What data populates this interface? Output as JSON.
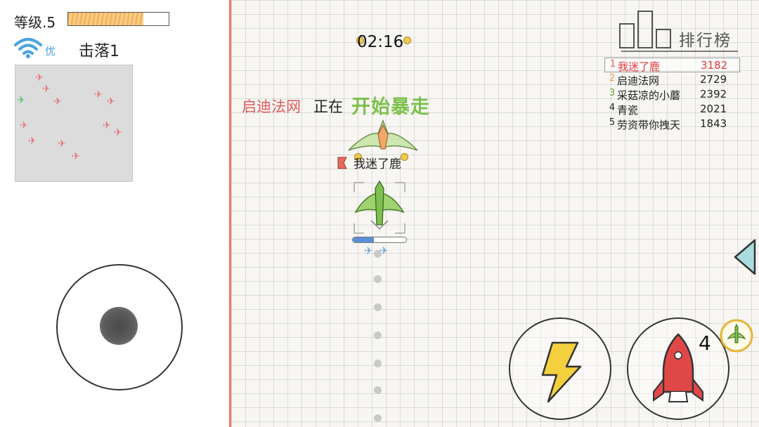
{
  "hud": {
    "level_label": "等级.5",
    "level_progress": 0.75,
    "signal_label": "优",
    "kills_label": "击落1"
  },
  "match": {
    "timer": "02:16",
    "announce_player": "启迪法网",
    "announce_mid": "正在",
    "announce_event": "开始暴走",
    "player_name": "我迷了鹿",
    "player_hp": 0.4
  },
  "leaderboard": {
    "title": "排行榜",
    "rows": [
      {
        "rank": "1",
        "name": "我迷了鹿",
        "score": "3182"
      },
      {
        "rank": "2",
        "name": "启迪法网",
        "score": "2729"
      },
      {
        "rank": "3",
        "name": "采菇凉的小蘑",
        "score": "2392"
      },
      {
        "rank": "4",
        "name": "青瓷",
        "score": "2021"
      },
      {
        "rank": "5",
        "name": "劳资带你拽天",
        "score": "1843"
      }
    ]
  },
  "skills": {
    "missile_count": "4"
  },
  "colors": {
    "margin_red": "#f0766b",
    "accent_green": "#7cc04a",
    "highlight_red": "#e23b3b",
    "hp_blue": "#5b8fd6"
  },
  "icons": [
    "wifi-icon",
    "lightning-icon",
    "rocket-icon",
    "arrow-left-icon",
    "pickup-icon",
    "rank-medal-icon",
    "leaderboard-bars-icon"
  ]
}
